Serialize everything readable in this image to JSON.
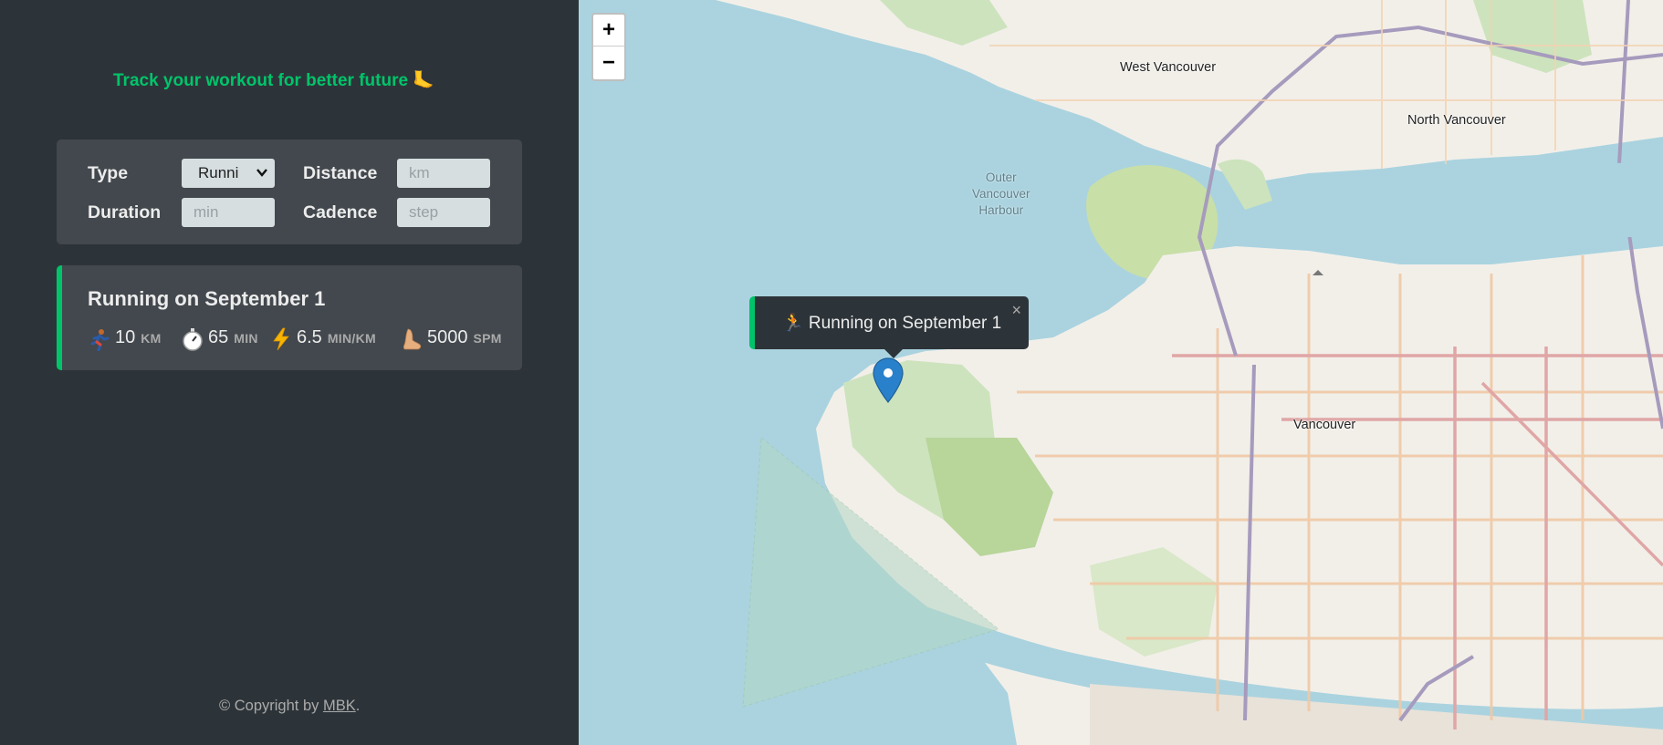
{
  "sidebar": {
    "tagline": "Track your workout for better future 🦶",
    "form": {
      "type_label": "Type",
      "type_value": "Runni",
      "distance_label": "Distance",
      "distance_placeholder": "km",
      "duration_label": "Duration",
      "duration_placeholder": "min",
      "cadence_label": "Cadence",
      "cadence_placeholder": "step"
    },
    "workouts": [
      {
        "title": "Running on September 1",
        "distance": "10",
        "distance_unit": "KM",
        "duration": "65",
        "duration_unit": "MIN",
        "pace": "6.5",
        "pace_unit": "MIN/KM",
        "cadence": "5000",
        "cadence_unit": "SPM",
        "icons": [
          "runner-icon",
          "stopwatch-icon",
          "lightning-icon",
          "foot-icon"
        ]
      }
    ],
    "copyright_prefix": "© Copyright by ",
    "copyright_link": "MBK",
    "copyright_suffix": "."
  },
  "map": {
    "zoom_in": "+",
    "zoom_out": "−",
    "popup_text": "🏃 Running on September 1",
    "popup_close": "×",
    "labels": {
      "west_vancouver": "West Vancouver",
      "north_vancouver": "North Vancouver",
      "vancouver": "Vancouver",
      "harbour_line1": "Outer",
      "harbour_line2": "Vancouver",
      "harbour_line3": "Harbour"
    }
  },
  "colors": {
    "accent": "#00c46a",
    "sidebar_bg": "#2d3439",
    "card_bg": "#42484d",
    "water": "#aad3df",
    "land": "#f2efe9"
  }
}
